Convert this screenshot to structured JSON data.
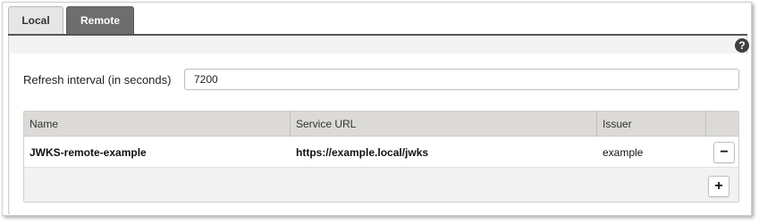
{
  "tabs": [
    {
      "label": "Local",
      "active": false
    },
    {
      "label": "Remote",
      "active": true
    }
  ],
  "help_icon": {
    "glyph": "?"
  },
  "refresh": {
    "label": "Refresh interval (in seconds)",
    "value": "7200"
  },
  "table": {
    "columns": [
      "Name",
      "Service URL",
      "Issuer"
    ],
    "rows": [
      {
        "name": "JWKS-remote-example",
        "service_url": "https://example.local/jwks",
        "issuer": "example"
      }
    ]
  },
  "buttons": {
    "remove_glyph": "−",
    "add_glyph": "+"
  }
}
